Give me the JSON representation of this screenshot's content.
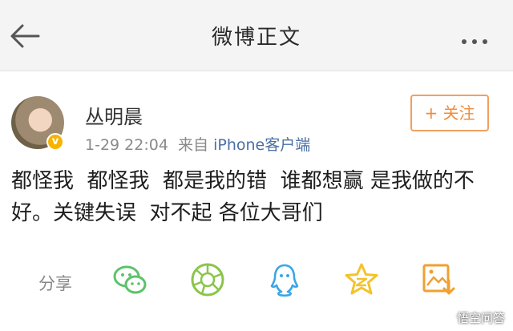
{
  "header": {
    "title": "微博正文"
  },
  "post": {
    "username": "丛明晨",
    "timestamp": "1-29 22:04",
    "source_prefix": "来自",
    "source": "iPhone客户端",
    "follow_label": "+ 关注",
    "text": "都怪我  都怪我  都是我的错  谁都想赢 是我做的不好。关键失误  对不起 各位大哥们"
  },
  "share": {
    "label": "分享",
    "targets": [
      "wechat-icon",
      "moments-icon",
      "qq-icon",
      "qzone-icon",
      "save-image-icon"
    ]
  },
  "watermark": "悟空问答",
  "colors": {
    "accent": "#f08c3c",
    "link": "#4a6fa5",
    "wechat": "#5cc36a",
    "moments": "#8ac44a",
    "qq": "#3aa6e8",
    "qzone": "#f5c22a",
    "save": "#f0a030"
  }
}
